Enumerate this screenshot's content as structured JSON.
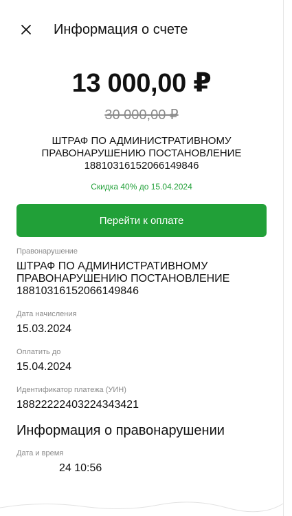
{
  "header": {
    "close_icon": "close-icon",
    "title": "Информация о счете"
  },
  "amount": {
    "current": "13 000,00 ₽",
    "old": "30 000,00 ₽"
  },
  "purpose": "ШТРАФ ПО АДМИНИСТРАТИВНОМУ\nПРАВОНАРУШЕНИЮ ПОСТАНОВЛЕНИЕ\n18810316152066149846",
  "discount": "Скидка 40% до 15.04.2024",
  "pay_button": "Перейти к оплате",
  "details": [
    {
      "label": "Правонарушение",
      "value": "ШТРАФ ПО АДМИНИСТРАТИВНОМУ\nПРАВОНАРУШЕНИЮ ПОСТАНОВЛЕНИЕ\n18810316152066149846"
    },
    {
      "label": "Дата начисления",
      "value": "15.03.2024"
    },
    {
      "label": "Оплатить до",
      "value": "15.04.2024"
    },
    {
      "label": "Идентификатор платежа (УИН)",
      "value": "18822222403224343421"
    }
  ],
  "offense_section": {
    "title": "Информация о правонарушении",
    "items": [
      {
        "label": "Дата и время",
        "value": "24 10:56"
      }
    ]
  },
  "colors": {
    "accent": "#21a038",
    "muted": "#8a8a8a"
  }
}
